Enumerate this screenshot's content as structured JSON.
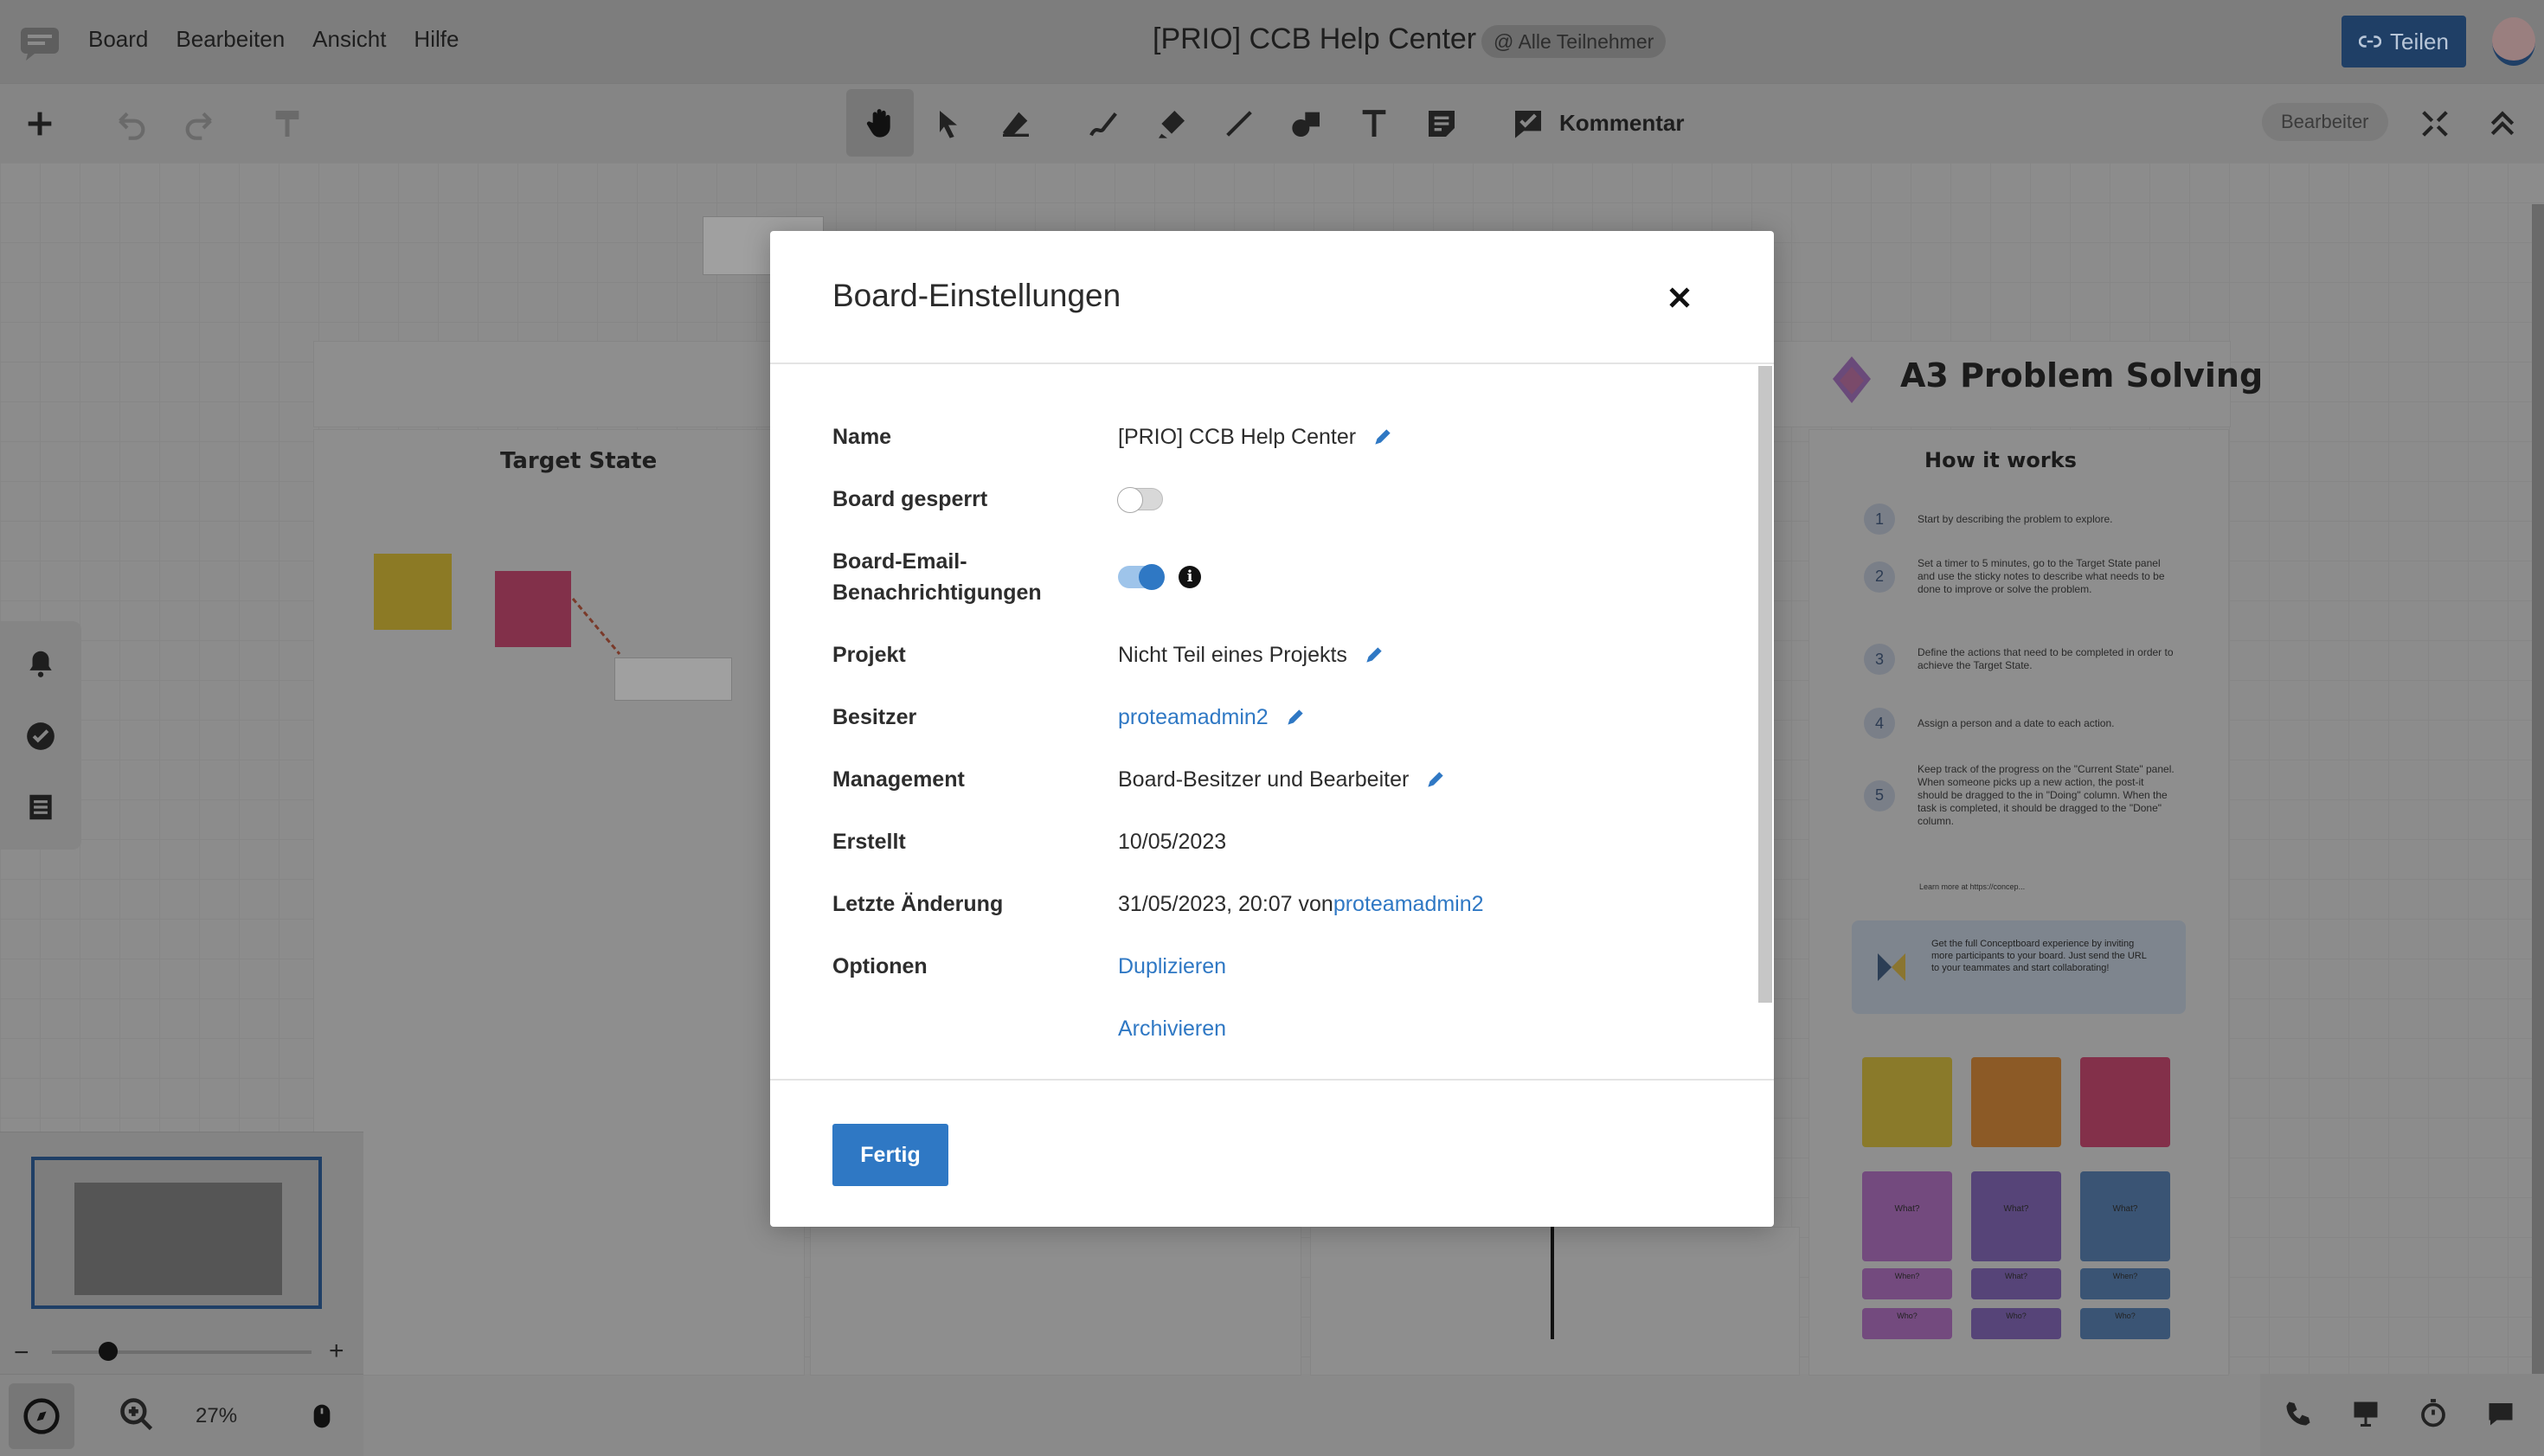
{
  "menubar": {
    "menu": [
      "Board",
      "Bearbeiten",
      "Ansicht",
      "Hilfe"
    ],
    "board_title": "[PRIO] CCB Help Center",
    "participants": "@ Alle Teilnehmer",
    "share_label": "Teilen"
  },
  "toolbar": {
    "comment_label": "Kommentar",
    "role_label": "Bearbeiter"
  },
  "canvas": {
    "target_state_title": "Target State",
    "a3_title": "A3 Problem Solving",
    "how_title": "How it works",
    "steps": [
      {
        "n": "1",
        "text": "Start by describing the problem to explore."
      },
      {
        "n": "2",
        "text": "Set a timer to 5 minutes, go to the Target State panel and use the sticky notes to describe what needs to be done to improve or solve the problem."
      },
      {
        "n": "3",
        "text": "Define the actions that need to be completed in order to achieve the Target State."
      },
      {
        "n": "4",
        "text": "Assign a person and a date to each action."
      },
      {
        "n": "5",
        "text": "Keep track of the progress on the \"Current State\" panel. When someone picks up a new action, the post-it should be dragged to the in \"Doing\" column. When the task is completed, it should be dragged to the \"Done\" column."
      }
    ],
    "learn_more": "Learn more at https://concep...",
    "info_text": "Get the full Conceptboard experience by inviting more participants to your board. Just send the URL to your teammates and start collaborating!",
    "sticky_labels": [
      "What?",
      "What?",
      "What?",
      "When?",
      "What?",
      "When?",
      "Who?",
      "Who?",
      "Who?"
    ]
  },
  "zoom": {
    "value": "27%"
  },
  "modal": {
    "title": "Board-Einstellungen",
    "rows": {
      "name": {
        "label": "Name",
        "value": "[PRIO] CCB Help Center"
      },
      "locked": {
        "label": "Board gesperrt"
      },
      "email": {
        "label_line1": "Board-Email-",
        "label_line2": "Benachrichtigungen"
      },
      "project": {
        "label": "Projekt",
        "value": "Nicht Teil eines Projekts"
      },
      "owner": {
        "label": "Besitzer",
        "value": "proteamadmin2"
      },
      "management": {
        "label": "Management",
        "value": "Board-Besitzer und Bearbeiter"
      },
      "created": {
        "label": "Erstellt",
        "value": "10/05/2023"
      },
      "modified": {
        "label": "Letzte Änderung",
        "value": "31/05/2023, 20:07 von",
        "user": "proteamadmin2"
      },
      "options": {
        "label": "Optionen",
        "duplicate": "Duplizieren",
        "archive": "Archivieren"
      }
    },
    "done_label": "Fertig"
  },
  "colors": {
    "accent": "#2f78c4",
    "share_bg": "#1f3f66"
  },
  "toggles": {
    "board_locked": false,
    "email_notifications": true
  }
}
